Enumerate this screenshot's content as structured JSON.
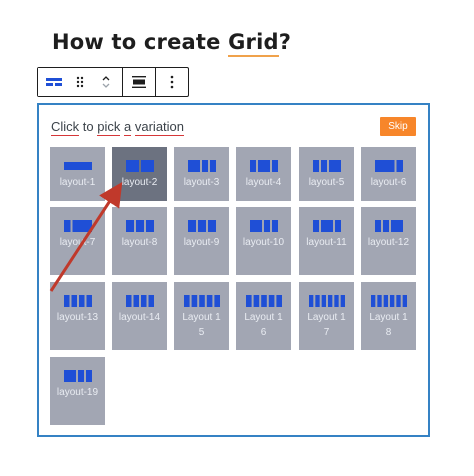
{
  "heading": {
    "pre": "How to create ",
    "underlined": "Grid",
    "post": "?"
  },
  "toolbar": {
    "items": [
      "block-type-icon",
      "drag-handle-icon",
      "move-up-down-icon",
      "align-icon",
      "more-options-icon"
    ]
  },
  "picker": {
    "prompt_words": [
      "Click",
      "to",
      "pick",
      "a",
      "variation"
    ],
    "skip_label": "Skip",
    "layouts": [
      {
        "label": "layout-1",
        "cols": [
          4
        ]
      },
      {
        "label": "layout-2",
        "cols": [
          2,
          2
        ]
      },
      {
        "label": "layout-3",
        "cols": [
          2,
          1,
          1
        ]
      },
      {
        "label": "layout-4",
        "cols": [
          1,
          2,
          1
        ]
      },
      {
        "label": "layout-5",
        "cols": [
          1,
          1,
          2
        ]
      },
      {
        "label": "layout-6",
        "cols": [
          3,
          1
        ]
      },
      {
        "label": "layout-7",
        "cols": [
          1,
          3
        ]
      },
      {
        "label": "layout-8",
        "cols": [
          1,
          1,
          1
        ]
      },
      {
        "label": "layout-9",
        "cols": [
          1,
          1,
          1
        ]
      },
      {
        "label": "layout-10",
        "cols": [
          2,
          1,
          1
        ]
      },
      {
        "label": "layout-11",
        "cols": [
          1,
          2,
          1
        ]
      },
      {
        "label": "layout-12",
        "cols": [
          1,
          1,
          2
        ]
      },
      {
        "label": "layout-13",
        "cols": [
          1,
          1,
          1,
          1
        ]
      },
      {
        "label": "layout-14",
        "cols": [
          1,
          1,
          1,
          1
        ]
      },
      {
        "label": "Layout 15",
        "cols": [
          1,
          1,
          1,
          1,
          1
        ]
      },
      {
        "label": "Layout 16",
        "cols": [
          1,
          1,
          1,
          1,
          1
        ]
      },
      {
        "label": "Layout 17",
        "cols": [
          1,
          1,
          1,
          1,
          1,
          1
        ]
      },
      {
        "label": "Layout 18",
        "cols": [
          1,
          1,
          1,
          1,
          1,
          1
        ]
      },
      {
        "label": "layout-19",
        "cols": [
          2,
          1,
          1
        ]
      }
    ],
    "selected_index": 1
  },
  "colors": {
    "accent": "#3582c4",
    "tile": "#a2a6b3",
    "tile_selected": "#6c7280",
    "icon": "#1f4fd6",
    "skip": "#f7862a",
    "arrow": "#c0392b"
  }
}
